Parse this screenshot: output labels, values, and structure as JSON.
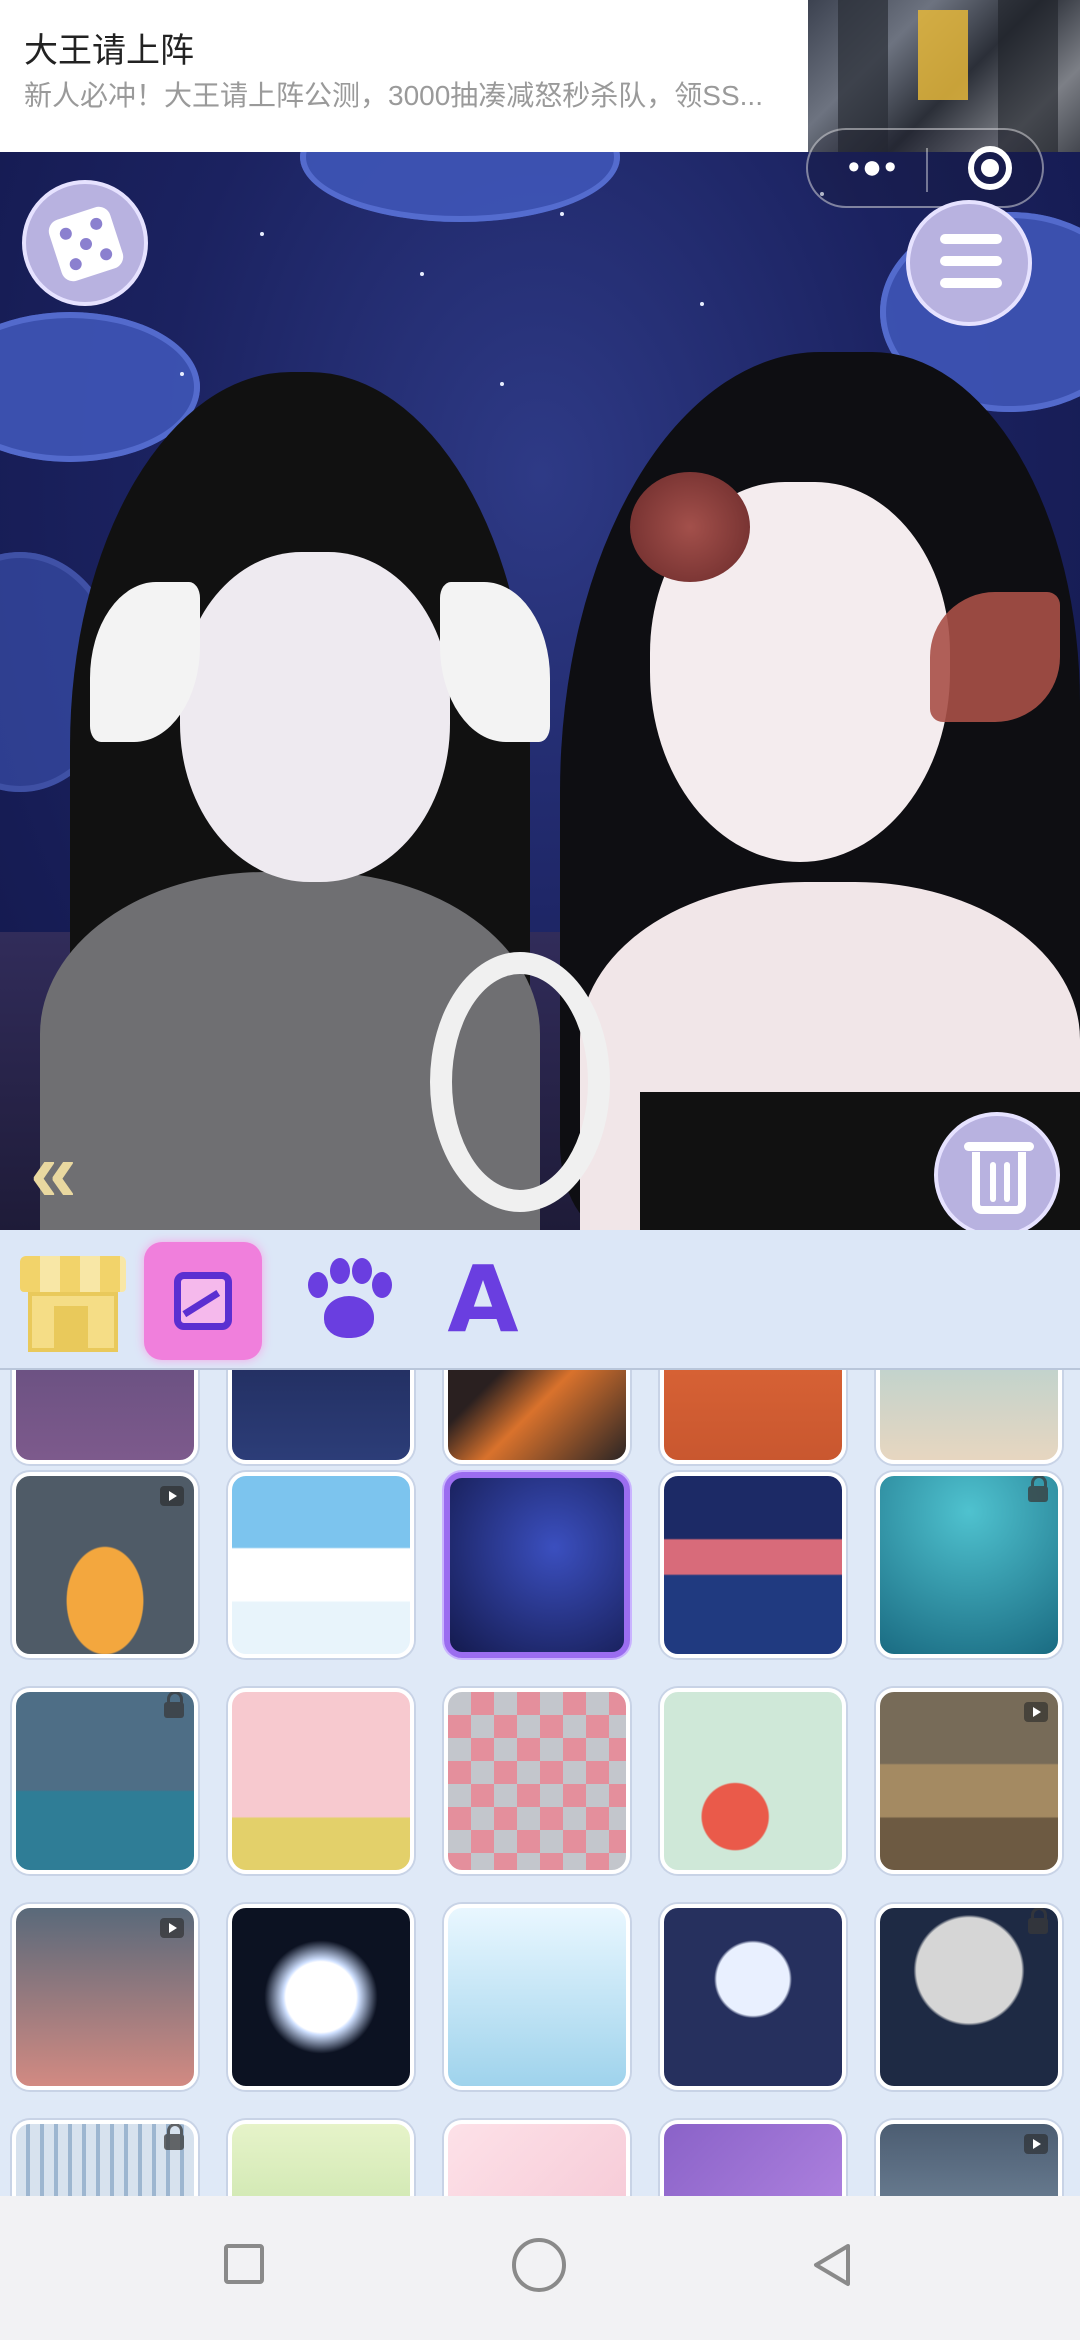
{
  "ad": {
    "title": "大王请上阵",
    "description": "新人必冲！大王请上阵公测，3000抽凑减怒秒杀队，领SS..."
  },
  "capsule": {
    "more_icon": "more-dots-icon",
    "close_icon": "target-close-icon"
  },
  "scene": {
    "buttons": {
      "randomize": "dice-icon",
      "menu": "list-menu-icon",
      "delete": "trash-icon",
      "collapse": "double-chevron-left-icon"
    }
  },
  "tabs": [
    {
      "name": "shop",
      "icon": "shop-icon",
      "active": false
    },
    {
      "name": "background",
      "icon": "image-icon",
      "active": true
    },
    {
      "name": "pet",
      "icon": "paw-icon",
      "active": false
    },
    {
      "name": "text",
      "icon": "letter-a-icon",
      "active": false
    }
  ],
  "tab_text_glyph": "A",
  "grid": {
    "selected_index": 7,
    "items": [
      {
        "theme": "purple-dusk",
        "badge": "none"
      },
      {
        "theme": "night-city",
        "badge": "none"
      },
      {
        "theme": "orange-roof",
        "badge": "none"
      },
      {
        "theme": "sunset-birds",
        "badge": "none"
      },
      {
        "theme": "pale-sea",
        "badge": "none"
      },
      {
        "theme": "desert-arch-cactus",
        "badge": "play"
      },
      {
        "theme": "sky-clouds",
        "badge": "none"
      },
      {
        "theme": "night-clouds-bridge",
        "badge": "none"
      },
      {
        "theme": "sea-mountains",
        "badge": "none"
      },
      {
        "theme": "underwater-teal",
        "badge": "lock"
      },
      {
        "theme": "cloudy-sea",
        "badge": "lock"
      },
      {
        "theme": "cherry-blossom",
        "badge": "none"
      },
      {
        "theme": "diamond-pattern",
        "badge": "none"
      },
      {
        "theme": "watermelon",
        "badge": "none"
      },
      {
        "theme": "desert-dunes",
        "badge": "play"
      },
      {
        "theme": "dusk-gradient",
        "badge": "play"
      },
      {
        "theme": "full-moon-dark",
        "badge": "none"
      },
      {
        "theme": "lily-pond",
        "badge": "none"
      },
      {
        "theme": "moon-stars",
        "badge": "none"
      },
      {
        "theme": "grey-moon",
        "badge": "lock"
      },
      {
        "theme": "blue-stripes",
        "badge": "lock"
      },
      {
        "theme": "green-hills",
        "badge": "none"
      },
      {
        "theme": "pink-pattern",
        "badge": "none"
      },
      {
        "theme": "purple-rays",
        "badge": "none"
      },
      {
        "theme": "grey-blue",
        "badge": "play"
      }
    ]
  },
  "colors": {
    "accent": "#9b6df0",
    "active_tab": "#f07fdc",
    "icon_purple": "#6a3ee0"
  },
  "system_nav": {
    "recent": "square-icon",
    "home": "circle-icon",
    "back": "triangle-back-icon"
  }
}
